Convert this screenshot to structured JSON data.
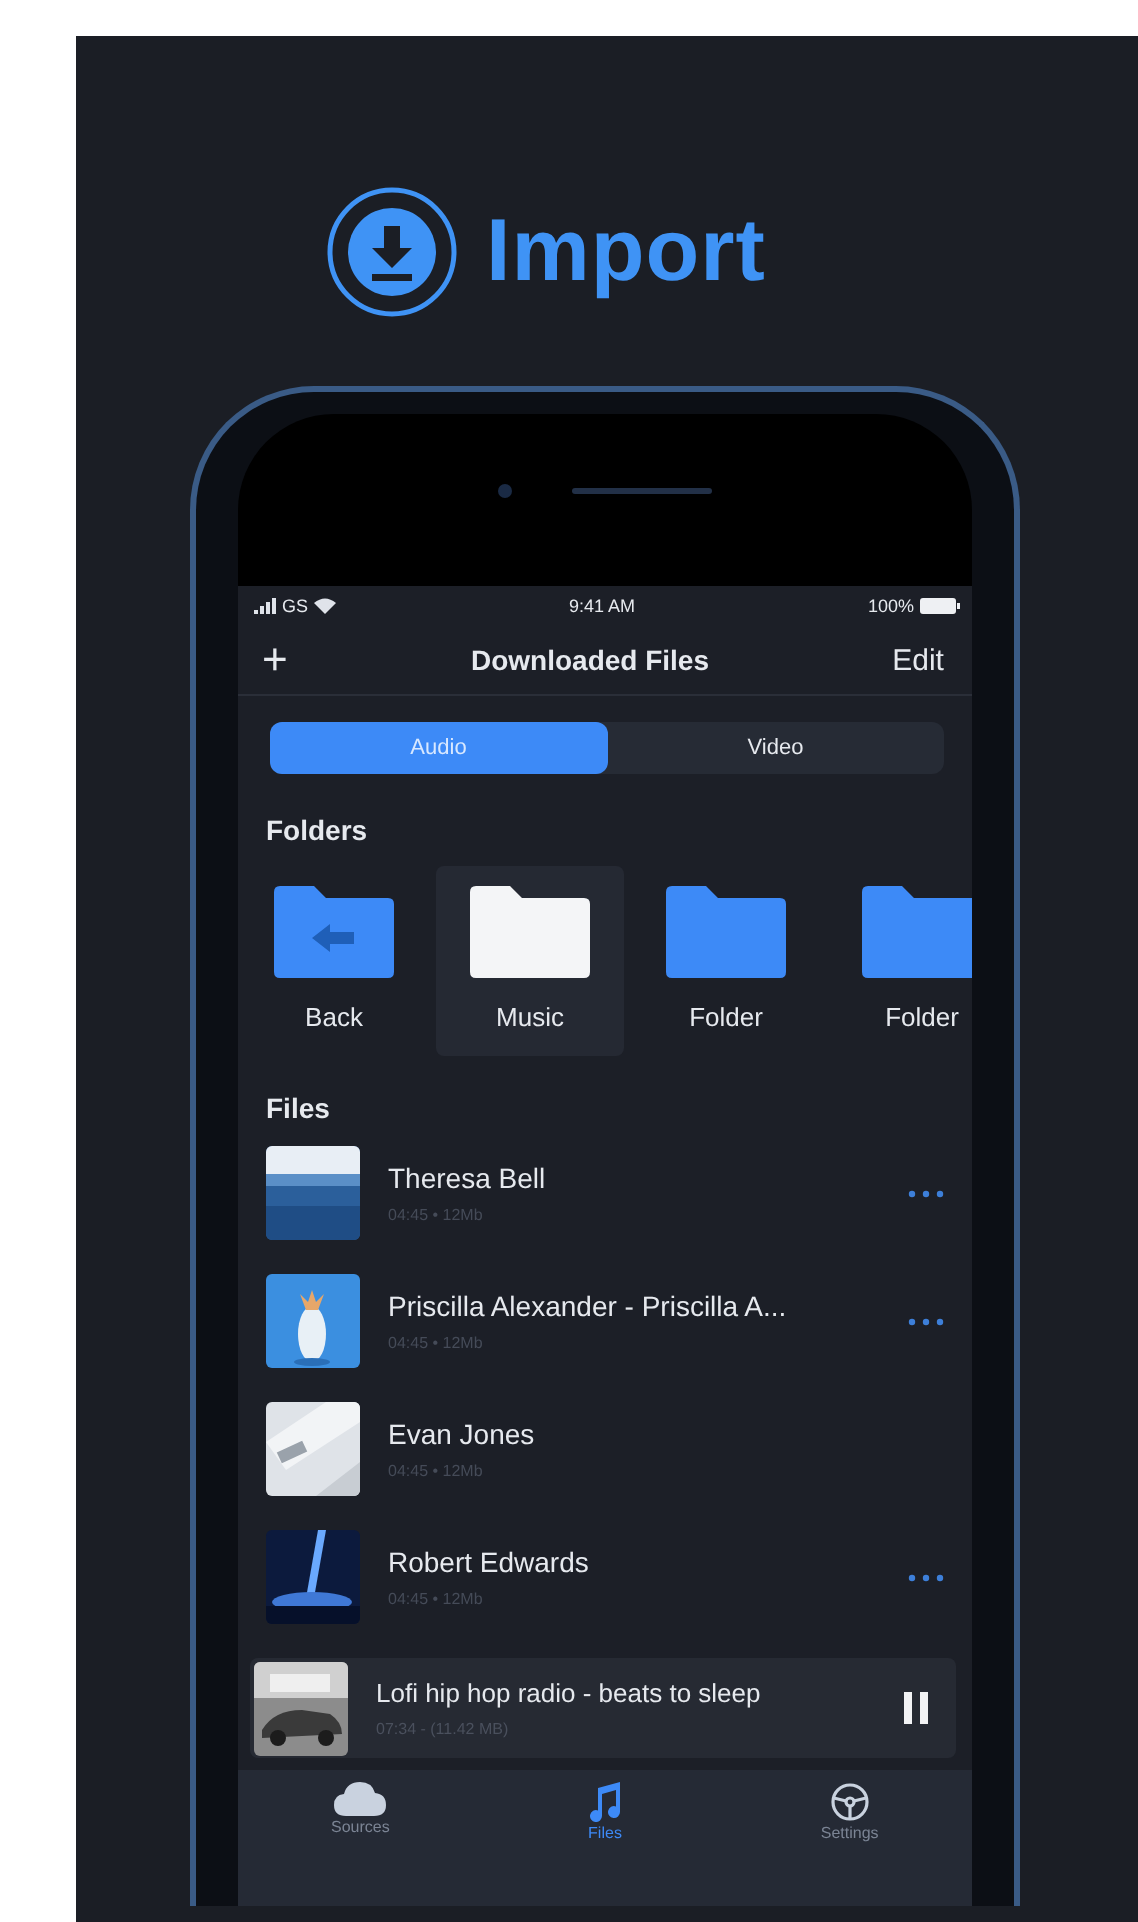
{
  "header": {
    "title": "Import"
  },
  "status_bar": {
    "carrier": "GS",
    "time": "9:41 AM",
    "battery": "100%"
  },
  "nav": {
    "add": "+",
    "title": "Downloaded Files",
    "edit": "Edit"
  },
  "segments": [
    {
      "label": "Audio",
      "selected": true
    },
    {
      "label": "Video",
      "selected": false
    }
  ],
  "folders_heading": "Folders",
  "folders": [
    {
      "label": "Back",
      "kind": "back",
      "selected": false
    },
    {
      "label": "Music",
      "kind": "folder",
      "selected": true
    },
    {
      "label": "Folder",
      "kind": "folder",
      "selected": false
    },
    {
      "label": "Folder",
      "kind": "folder",
      "selected": false
    }
  ],
  "files_heading": "Files",
  "files": [
    {
      "title": "Theresa Bell",
      "meta": "04:45 • 12Mb",
      "menu": true
    },
    {
      "title": "Priscilla Alexander - Priscilla A...",
      "meta": "04:45 • 12Mb",
      "menu": true
    },
    {
      "title": "Evan Jones",
      "meta": "04:45 • 12Mb",
      "menu": false
    },
    {
      "title": "Robert Edwards",
      "meta": "04:45 • 12Mb",
      "menu": true
    }
  ],
  "player": {
    "title": "Lofi hip hop radio - beats to sleep",
    "meta": "07:34 - (11.42 MB)",
    "playing": true
  },
  "tabs": [
    {
      "label": "Sources",
      "kind": "cloud",
      "selected": false
    },
    {
      "label": "Files",
      "kind": "music",
      "selected": true
    },
    {
      "label": "Settings",
      "kind": "wheel",
      "selected": false
    }
  ]
}
